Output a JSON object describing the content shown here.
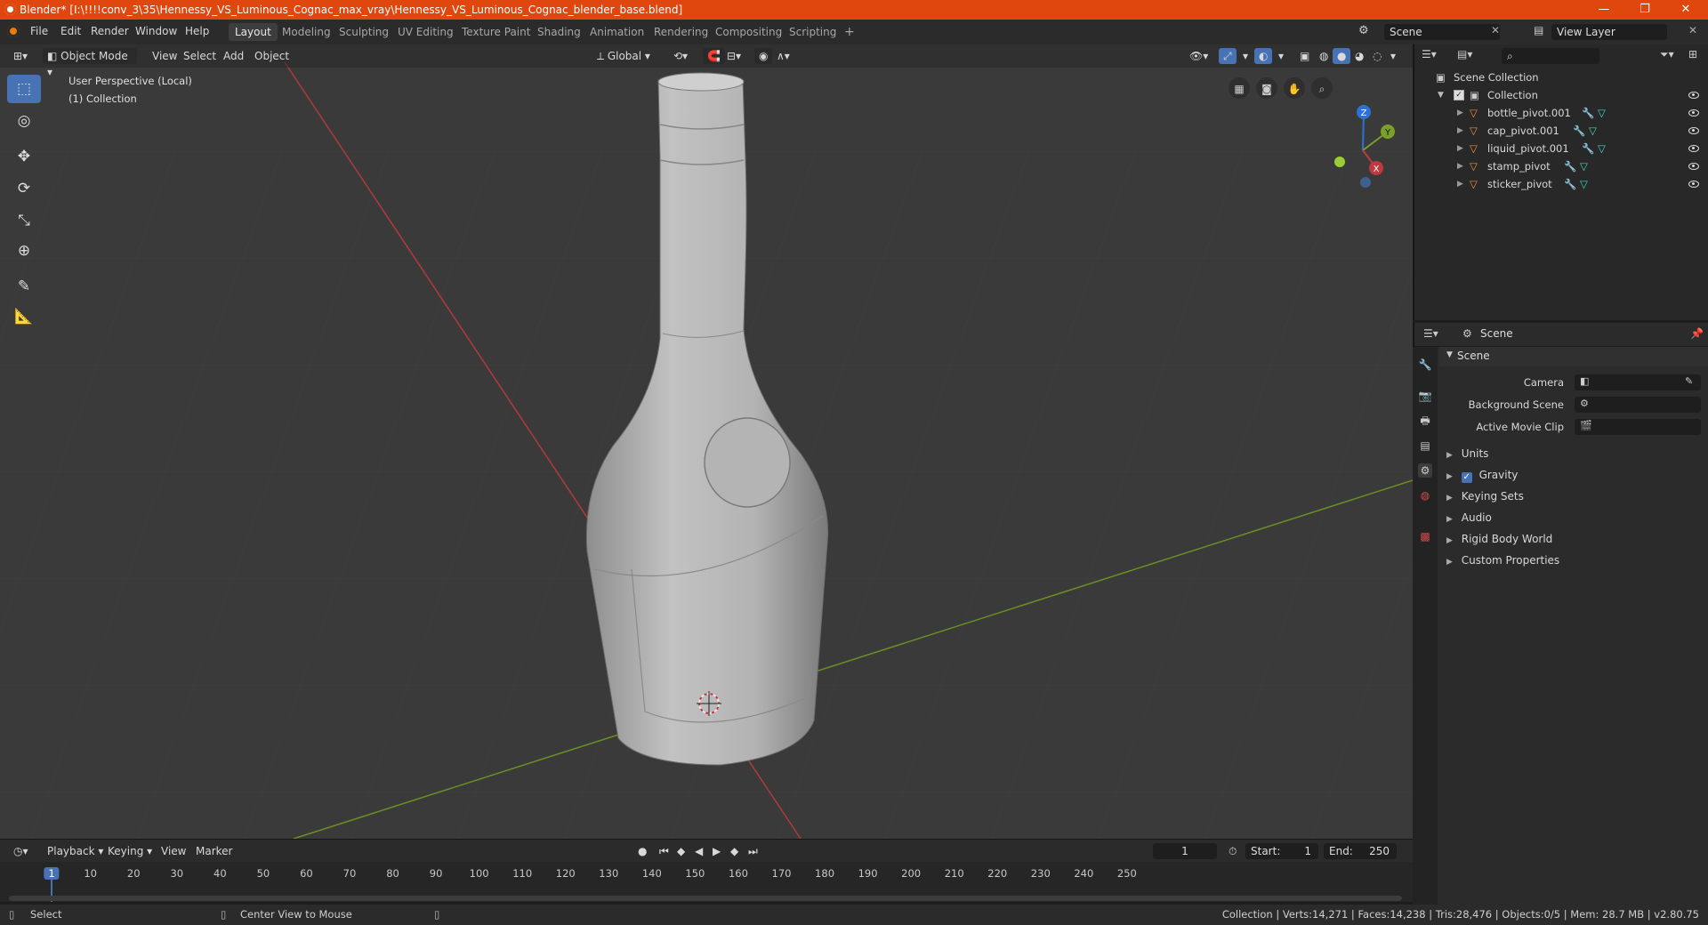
{
  "window": {
    "title": "Blender* [I:\\!!!!conv_3\\35\\Hennessy_VS_Luminous_Cognac_max_vray\\Hennessy_VS_Luminous_Cognac_blender_base.blend]",
    "minimize": "—",
    "maximize": "❐",
    "close": "✕"
  },
  "menu": [
    "File",
    "Edit",
    "Render",
    "Window",
    "Help"
  ],
  "workspaces": [
    "Layout",
    "Modeling",
    "Sculpting",
    "UV Editing",
    "Texture Paint",
    "Shading",
    "Animation",
    "Rendering",
    "Compositing",
    "Scripting",
    "+"
  ],
  "active_workspace": "Layout",
  "scene_selector": "Scene",
  "view_layer_selector": "View Layer",
  "viewport_header": {
    "mode": "Object Mode",
    "menus": [
      "View",
      "Select",
      "Add",
      "Object"
    ],
    "orientation": "Global"
  },
  "viewport_info": {
    "perspective": "User Perspective (Local)",
    "collection": "(1) Collection"
  },
  "gizmo": {
    "z": "Z",
    "y": "Y",
    "x": "X"
  },
  "outliner": {
    "root": "Scene Collection",
    "collection": "Collection",
    "objects": [
      "bottle_pivot.001",
      "cap_pivot.001",
      "liquid_pivot.001",
      "stamp_pivot",
      "sticker_pivot"
    ]
  },
  "properties": {
    "header": "Scene",
    "panel": "Scene",
    "fields": [
      {
        "label": "Camera"
      },
      {
        "label": "Background Scene"
      },
      {
        "label": "Active Movie Clip"
      }
    ],
    "sections": [
      "Units",
      "Gravity",
      "Keying Sets",
      "Audio",
      "Rigid Body World",
      "Custom Properties"
    ]
  },
  "timeline": {
    "menus": [
      "Playback",
      "Keying",
      "View",
      "Marker"
    ],
    "current_frame": "1",
    "start_label": "Start:",
    "start": "1",
    "end_label": "End:",
    "end": "250",
    "ticks": [
      "1",
      "10",
      "20",
      "30",
      "40",
      "50",
      "60",
      "70",
      "80",
      "90",
      "100",
      "110",
      "120",
      "130",
      "140",
      "150",
      "160",
      "170",
      "180",
      "190",
      "200",
      "210",
      "220",
      "230",
      "240",
      "250"
    ]
  },
  "statusbar": {
    "left1": "Select",
    "left2": "Center View to Mouse",
    "stats": "Collection | Verts:14,271 | Faces:14,238 | Tris:28,476 | Objects:0/5 | Mem: 28.7 MB | v2.80.75"
  },
  "colors": {
    "title_bar": "#e0470f",
    "accent": "#4772b3",
    "x_axis": "#c0393f",
    "y_axis": "#7ba02a",
    "object_icon": "#e8923a",
    "modifier_icon": "#6ab3f0",
    "mesh_icon": "#3ed8c0"
  }
}
